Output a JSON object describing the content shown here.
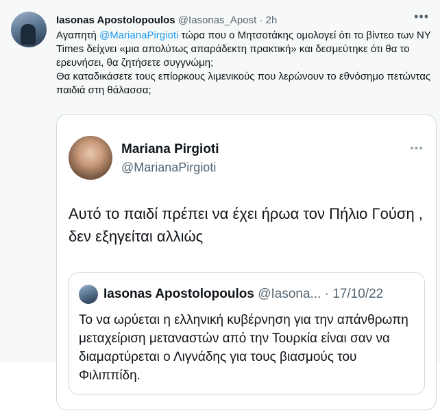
{
  "tweet": {
    "author_name": "Iasonas Apostolopoulos",
    "author_handle": "@Iasonas_Apost",
    "separator": " · ",
    "time": "2h",
    "text_before": "Αγαπητή ",
    "mention": "@MarianaPirgioti",
    "text_after": " τώρα που ο Μητσοτάκης ομολογεί ότι το βίντεο των NY Times δείχνει «μια απολύτως απαράδεκτη πρακτική» και δεσμεύτηκε ότι θα το ερευνήσει, θα ζητήσετε συγγνώμη;",
    "text_line2": "Θα καταδικάσετε τους επίορκους λιμενικούς που λερώνουν το εθνόσημο πετώντας παιδιά στη θάλασσα;",
    "more_icon": "more-icon"
  },
  "quoted": {
    "author_name": "Mariana Pirgioti",
    "author_handle": "@MarianaPirgioti",
    "text": "Αυτό το παιδί πρέπει να έχει ήρωα τον Πήλιο Γούση , δεν εξηγείται αλλιώς",
    "nested": {
      "author_name": "Iasonas Apostolopoulos",
      "author_handle": "@Iasona...",
      "separator": " · ",
      "date": "17/10/22",
      "text": "Το να ωρύεται η ελληνική κυβέρνηση για την απάνθρωπη μεταχείριση μεταναστών από την Τουρκία είναι σαν να διαμαρτύρεται ο Λιγνάδης για τους βιασμούς του Φιλιππίδη."
    }
  },
  "colors": {
    "mention": "#1d9bf0",
    "secondary_text": "#536471",
    "border": "#cfd9de",
    "feed_background": "#f7f9f9"
  }
}
